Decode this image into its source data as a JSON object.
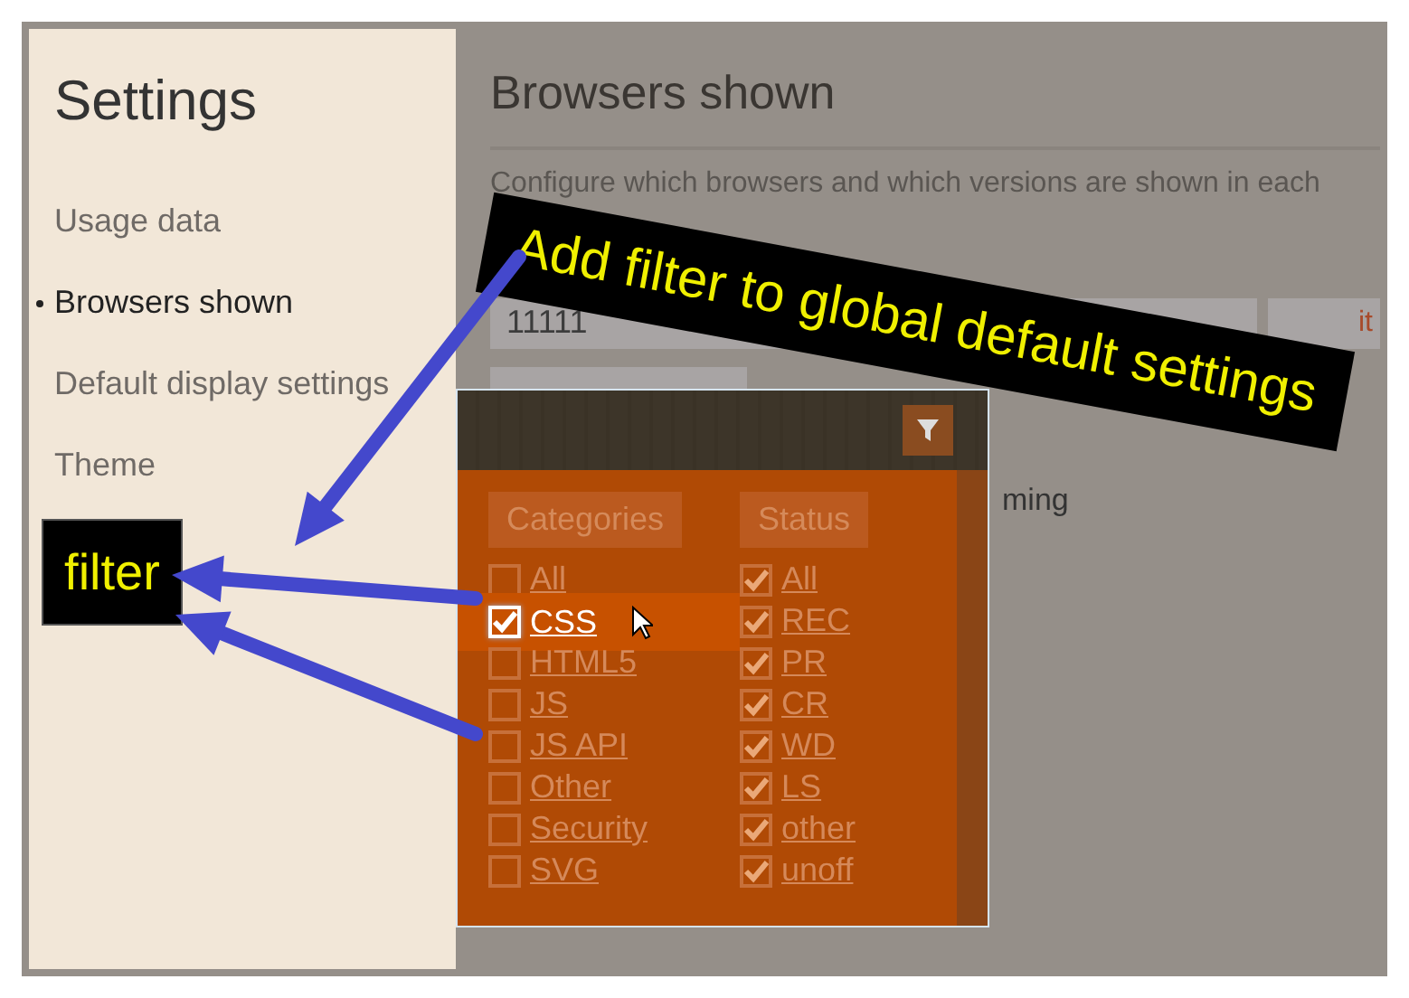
{
  "sidebar": {
    "title": "Settings",
    "items": [
      {
        "label": "Usage data",
        "selected": false
      },
      {
        "label": "Browsers shown",
        "selected": true
      },
      {
        "label": "Default display settings",
        "selected": false
      },
      {
        "label": "Theme",
        "selected": false
      }
    ]
  },
  "main": {
    "title": "Browsers shown",
    "description": "Configure which browsers and which versions are shown in each",
    "field_value": "11111",
    "field_button": "it",
    "partial_label": "ming"
  },
  "filter_popup": {
    "columns": [
      {
        "heading": "Categories",
        "items": [
          {
            "label": "All",
            "checked": false,
            "hovered": false
          },
          {
            "label": "CSS",
            "checked": true,
            "hovered": true
          },
          {
            "label": "HTML5",
            "checked": false,
            "hovered": false
          },
          {
            "label": "JS",
            "checked": false,
            "hovered": false
          },
          {
            "label": "JS API",
            "checked": false,
            "hovered": false
          },
          {
            "label": "Other",
            "checked": false,
            "hovered": false
          },
          {
            "label": "Security",
            "checked": false,
            "hovered": false
          },
          {
            "label": "SVG",
            "checked": false,
            "hovered": false
          }
        ]
      },
      {
        "heading": "Status",
        "items": [
          {
            "label": "All",
            "checked": true,
            "hovered": false
          },
          {
            "label": "REC",
            "checked": true,
            "hovered": false
          },
          {
            "label": "PR",
            "checked": true,
            "hovered": false
          },
          {
            "label": "CR",
            "checked": true,
            "hovered": false
          },
          {
            "label": "WD",
            "checked": true,
            "hovered": false
          },
          {
            "label": "LS",
            "checked": true,
            "hovered": false
          },
          {
            "label": "other",
            "checked": true,
            "hovered": false
          },
          {
            "label": "unoff",
            "checked": true,
            "hovered": false
          }
        ]
      }
    ]
  },
  "annotations": {
    "callout": "Add filter to global default settings",
    "label": "filter"
  }
}
